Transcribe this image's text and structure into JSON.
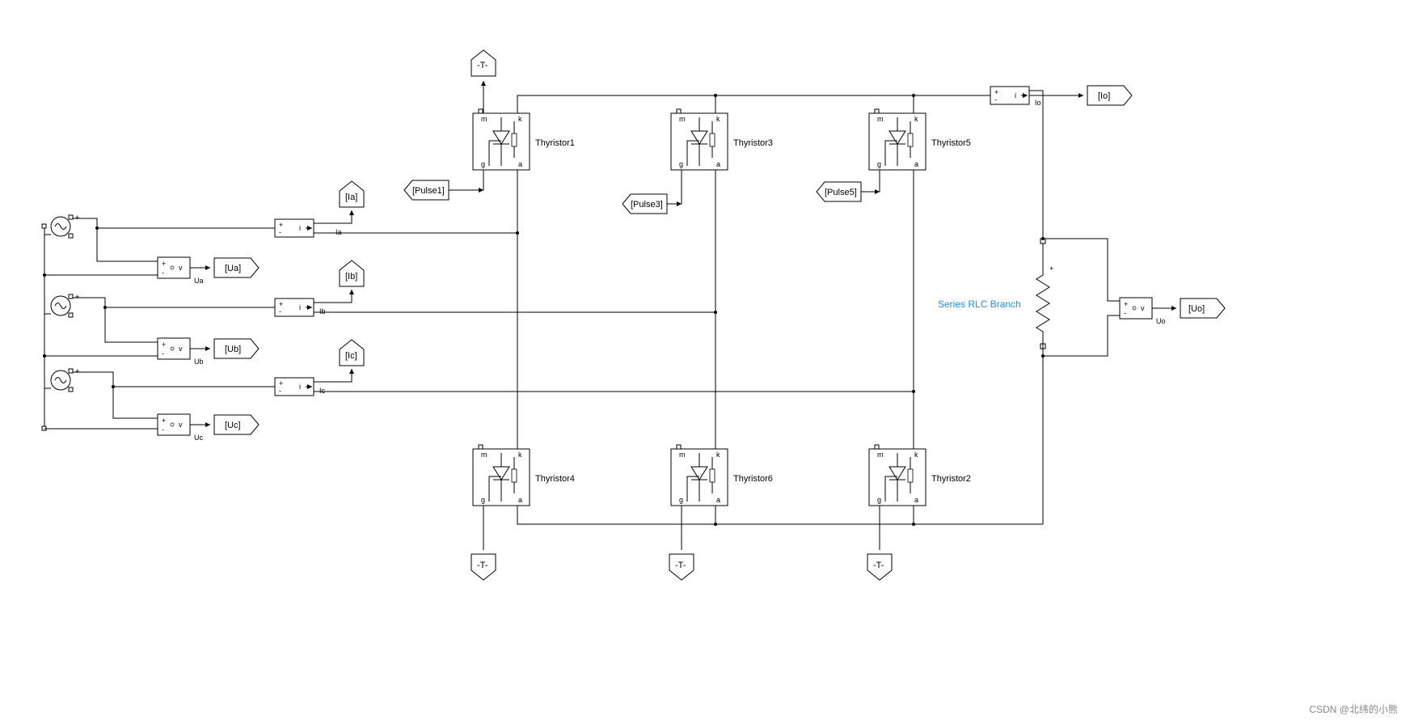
{
  "thyristors": {
    "t1": "Thyristor1",
    "t2": "Thyristor2",
    "t3": "Thyristor3",
    "t4": "Thyristor4",
    "t5": "Thyristor5",
    "t6": "Thyristor6"
  },
  "pulses": {
    "p1": "[Pulse1]",
    "p3": "[Pulse3]",
    "p5": "[Pulse5]"
  },
  "tags": {
    "ia": "[Ia]",
    "ib": "[Ib]",
    "ic": "[Ic]",
    "ua": "[Ua]",
    "ub": "[Ub]",
    "uc": "[Uc]",
    "io": "[Io]",
    "uo": "[Uo]",
    "terminator": "-T-"
  },
  "sensors": {
    "ia_sig": "Ia",
    "ib_sig": "Ib",
    "ic_sig": "Ic",
    "io_sig": "Io",
    "ua_lbl": "Ua",
    "ub_lbl": "Ub",
    "uc_lbl": "Uc",
    "uo_lbl": "Uo"
  },
  "rlc": "Series RLC Branch",
  "watermark": "CSDN @北纬的小熊"
}
